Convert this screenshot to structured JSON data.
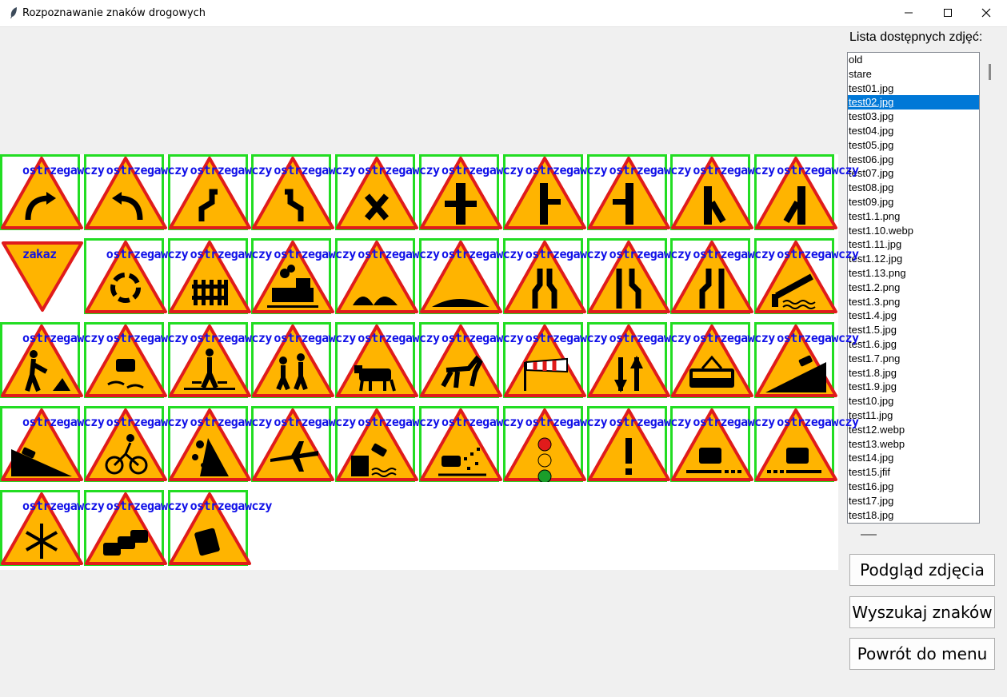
{
  "window": {
    "title": "Rozpoznawanie znaków drogowych"
  },
  "sidebar": {
    "label": "Lista dostępnych zdjęć:",
    "files": [
      "old",
      "stare",
      "test01.jpg",
      "test02.jpg",
      "test03.jpg",
      "test04.jpg",
      "test05.jpg",
      "test06.jpg",
      "test07.jpg",
      "test08.jpg",
      "test09.jpg",
      "test1.1.png",
      "test1.10.webp",
      "test1.11.jpg",
      "test1.12.jpg",
      "test1.13.png",
      "test1.2.png",
      "test1.3.png",
      "test1.4.jpg",
      "test1.5.jpg",
      "test1.6.jpg",
      "test1.7.png",
      "test1.8.jpg",
      "test1.9.jpg",
      "test10.jpg",
      "test11.jpg",
      "test12.webp",
      "test13.webp",
      "test14.jpg",
      "test15.jfif",
      "test16.jpg",
      "test17.jpg",
      "test18.jpg"
    ],
    "selected_file": "test02.jpg",
    "buttons": {
      "preview": "Podgląd zdjęcia",
      "search": "Wyszukaj znaków",
      "back": "Powrót do menu"
    }
  },
  "detections": {
    "rows": [
      {
        "labels": [
          "ostrzegawczy",
          "ostrzegawczy",
          "ostrzegawczy",
          "ostrzegawczy",
          "ostrzegawczy",
          "ostrzegawczy",
          "ostrzegawczy",
          "ostrzegawczy",
          "ostrzegawczy",
          "ostrzegawczy"
        ],
        "icons": [
          "curve-left-icon",
          "curve-right-icon",
          "double-curve-right-icon",
          "double-curve-left-icon",
          "crossroads-icon",
          "crossroads-main-road-icon",
          "side-road-right-icon",
          "side-road-left-icon",
          "road-merge-right-icon",
          "road-merge-left-icon"
        ]
      },
      {
        "labels": [
          "zakaz",
          "ostrzegawczy",
          "ostrzegawczy",
          "ostrzegawczy",
          "ostrzegawczy",
          "ostrzegawczy",
          "ostrzegawczy",
          "ostrzegawczy",
          "ostrzegawczy",
          "ostrzegawczy"
        ],
        "icons": [
          "yield-icon",
          "roundabout-icon",
          "railway-crossing-barrier-icon",
          "railway-crossing-train-icon",
          "uneven-road-icon",
          "speed-bump-icon",
          "road-narrows-both-icon",
          "road-narrows-right-icon",
          "road-narrows-left-icon",
          "moving-bridge-icon"
        ]
      },
      {
        "labels": [
          "ostrzegawczy",
          "ostrzegawczy",
          "ostrzegawczy",
          "ostrzegawczy",
          "ostrzegawczy",
          "ostrzegawczy",
          "ostrzegawczy",
          "ostrzegawczy",
          "ostrzegawczy",
          "ostrzegawczy"
        ],
        "icons": [
          "roadworks-icon",
          "slippery-road-icon",
          "pedestrian-crossing-icon",
          "children-icon",
          "cattle-icon",
          "wild-animals-icon",
          "crosswind-icon",
          "two-way-traffic-icon",
          "tram-icon",
          "steep-descent-icon"
        ]
      },
      {
        "labels": [
          "ostrzegawczy",
          "ostrzegawczy",
          "ostrzegawczy",
          "ostrzegawczy",
          "ostrzegawczy",
          "ostrzegawczy",
          "ostrzegawczy",
          "ostrzegawczy",
          "ostrzegawczy",
          "ostrzegawczy"
        ],
        "icons": [
          "steep-ascent-icon",
          "cyclists-icon",
          "falling-rocks-icon",
          "low-flying-aircraft-icon",
          "riverbank-icon",
          "loose-chippings-icon",
          "traffic-lights-icon",
          "other-danger-icon",
          "dangerous-shoulder-right-icon",
          "dangerous-shoulder-left-icon"
        ]
      },
      {
        "labels": [
          "ostrzegawczy",
          "ostrzegawczy",
          "ostrzegawczy"
        ],
        "icons": [
          "icy-road-icon",
          "traffic-jam-icon",
          "accident-icon"
        ]
      }
    ]
  },
  "colors": {
    "box": "#22dd22",
    "label": "#1010e8",
    "sign_fill": "#ffb400",
    "sign_border": "#e01b1b",
    "selection": "#0078d7"
  }
}
